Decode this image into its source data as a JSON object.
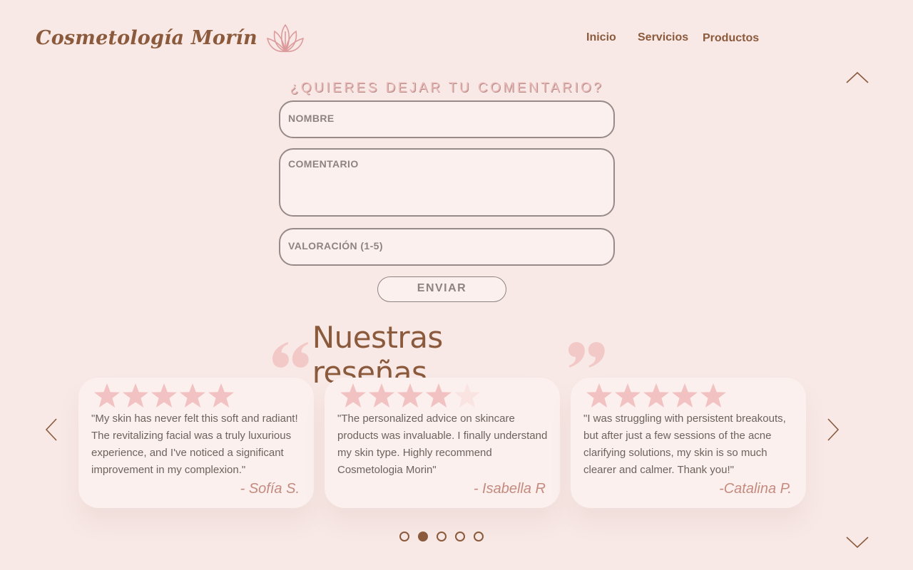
{
  "header": {
    "brand_name": "Cosmetología Morín",
    "nav": [
      {
        "label": "Inicio"
      },
      {
        "label": "Servicios"
      },
      {
        "label": "Productos"
      }
    ]
  },
  "form": {
    "title": "¿QUIERES DEJAR TU COMENTARIO?",
    "name_placeholder": "NOMBRE",
    "comment_placeholder": "COMENTARIO",
    "rating_placeholder": "VALORACIÓN (1-5)",
    "submit_label": "ENVIAR"
  },
  "reviews": {
    "title": "Nuestras reseñas",
    "items": [
      {
        "rating": 5,
        "text": "\"My skin has never felt this soft and radiant! The revitalizing facial was a truly luxurious experience, and I've noticed a significant improvement in my complexion.\"",
        "author": "- Sofía S."
      },
      {
        "rating": 4,
        "text": "\"The personalized advice on skincare products was invaluable. I finally understand my skin type. Highly recommend Cosmetologia Morin\"",
        "author": "- Isabella R"
      },
      {
        "rating": 5,
        "text": "\"I was struggling with persistent breakouts, but after just a few sessions of the acne clarifying solutions, my skin is so much clearer and calmer. Thank you!\"",
        "author": "-Catalina P."
      }
    ],
    "pagination": {
      "total": 5,
      "active": 2
    }
  },
  "colors": {
    "background": "#f8e9e6",
    "brand_brown": "#8b5a3c",
    "accent_pink": "#f2c2c2",
    "card": "#fbf0ee"
  },
  "icons": [
    "lotus-logo-icon",
    "chevron-up-icon",
    "chevron-down-icon",
    "chevron-left-icon",
    "chevron-right-icon",
    "quote-open-icon",
    "quote-close-icon",
    "star-icon"
  ]
}
